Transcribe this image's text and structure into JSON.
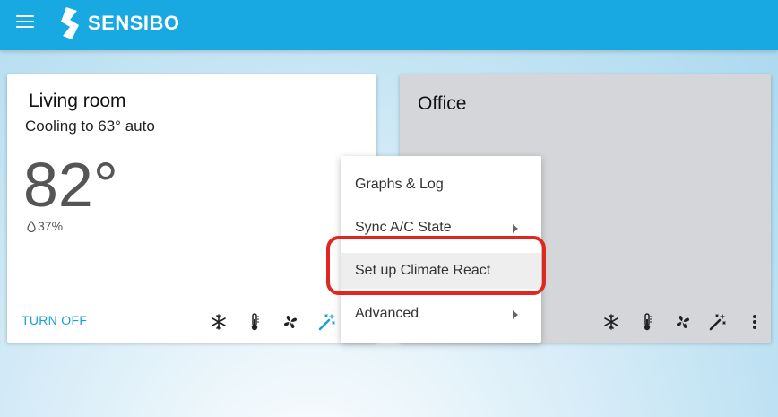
{
  "header": {
    "brand": "SENSIBO",
    "background_color": "#18a9e3",
    "menu_icon": "hamburger-icon",
    "logo_icon": "sensibo-logo-icon"
  },
  "rooms": [
    {
      "name": "Living room",
      "status": "Cooling to 63° auto",
      "temperature": "82°",
      "humidity": "37%",
      "turn_off_label": "TURN OFF",
      "accent_color": "#1b9fd6",
      "controls": [
        "snowflake-icon",
        "thermometer-icon",
        "fan-auto-icon",
        "magic-wand-icon"
      ]
    },
    {
      "name": "Office",
      "controls": [
        "snowflake-icon",
        "thermometer-icon",
        "fan-auto-icon",
        "magic-wand-icon",
        "more-vert-icon"
      ]
    }
  ],
  "dropdown": {
    "items": [
      {
        "label": "Graphs & Log",
        "has_submenu": false
      },
      {
        "label": "Sync A/C State",
        "has_submenu": true
      },
      {
        "label": "Set up Climate React",
        "has_submenu": false,
        "highlighted": true
      },
      {
        "label": "Advanced",
        "has_submenu": true
      }
    ],
    "highlight_ring_color": "#e0261f"
  }
}
